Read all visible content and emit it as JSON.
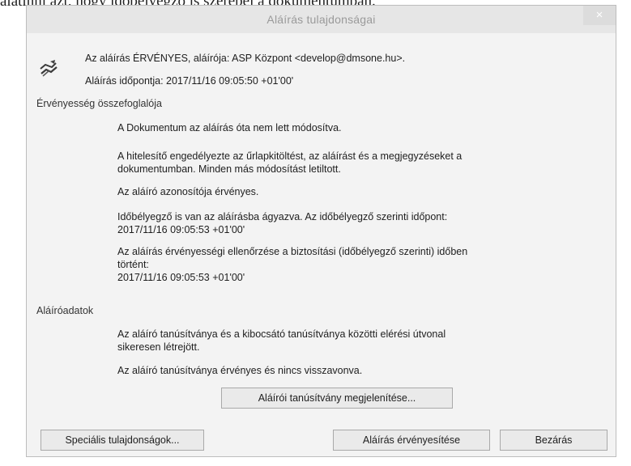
{
  "document": {
    "top_text": "alatinni azt, hogy időbélyegző is szerepel a dokumentumban."
  },
  "dialog": {
    "title": "Aláírás tulajdonságai",
    "close_glyph": "×",
    "icon": "signature-icon",
    "status_line": "Az aláírás ÉRVÉNYES, aláírója: ASP Központ <develop@dmsone.hu>.",
    "time_line": "Aláírás időpontja:  2017/11/16 09:05:50 +01'00'",
    "validity": {
      "heading": "Érvényesség összefoglalója",
      "items": [
        "A Dokumentum az aláírás óta nem lett módosítva.",
        "A hitelesítő engedélyezte az űrlapkitöltést, az aláírást és a megjegyzéseket a\ndokumentumban. Minden más módosítást letiltott.",
        "Az aláíró azonosítója érvényes.",
        "Időbélyegző is van az aláírásba ágyazva. Az időbélyegző szerinti időpont:\n2017/11/16 09:05:53 +01'00'",
        "Az aláírás érvényességi ellenőrzése a biztosítási (időbélyegző szerinti) időben\ntörtént:\n2017/11/16 09:05:53 +01'00'"
      ]
    },
    "signer": {
      "heading": "Aláíróadatok",
      "items": [
        "Az aláíró tanúsítványa és a kibocsátó tanúsítványa közötti elérési útvonal\nsikeresen létrejött.",
        "Az aláíró tanúsítványa érvényes és nincs visszavonva."
      ],
      "show_cert_button": "Aláírói tanúsítvány megjelenítése..."
    },
    "buttons": {
      "special_properties": "Speciális tulajdonságok...",
      "validate": "Aláírás érvényesítése",
      "close": "Bezárás"
    }
  }
}
